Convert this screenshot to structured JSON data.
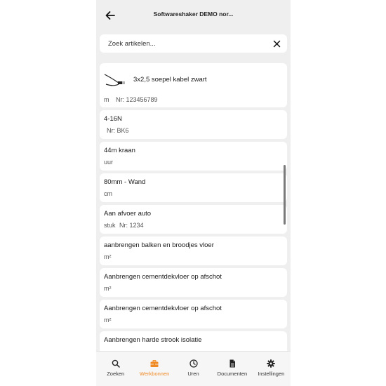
{
  "header": {
    "title": "Softwareshaker DEMO nor..."
  },
  "search": {
    "placeholder": "Zoek artikelen..."
  },
  "items": [
    {
      "name": "3x2,5 soepel kabel zwart",
      "unit": "m",
      "nr": "Nr: 123456789",
      "has_thumb": true
    },
    {
      "name": "4-16N",
      "unit": "",
      "nr": "Nr: BK6"
    },
    {
      "name": "44m kraan",
      "unit": "uur",
      "nr": ""
    },
    {
      "name": "80mm - Wand",
      "unit": "cm",
      "nr": ""
    },
    {
      "name": "Aan afvoer auto",
      "unit": "stuk",
      "nr": "Nr: 1234"
    },
    {
      "name": "aanbrengen balken en broodjes vloer",
      "unit": "m²",
      "nr": ""
    },
    {
      "name": "Aanbrengen cementdekvloer op afschot",
      "unit": "m²",
      "nr": ""
    },
    {
      "name": "Aanbrengen cementdekvloer op afschot",
      "unit": "m²",
      "nr": ""
    },
    {
      "name": "Aanbrengen harde strook isolatie",
      "unit": "",
      "nr": ""
    }
  ],
  "tabs": [
    {
      "label": "Zoeken",
      "icon": "search-icon"
    },
    {
      "label": "Werkbonnen",
      "icon": "toolbox-icon",
      "active": true
    },
    {
      "label": "Uren",
      "icon": "clock-icon"
    },
    {
      "label": "Documenten",
      "icon": "document-icon"
    },
    {
      "label": "Instellingen",
      "icon": "gear-icon"
    }
  ],
  "colors": {
    "accent": "#f08a24",
    "background": "#efefef",
    "card": "#ffffff"
  }
}
